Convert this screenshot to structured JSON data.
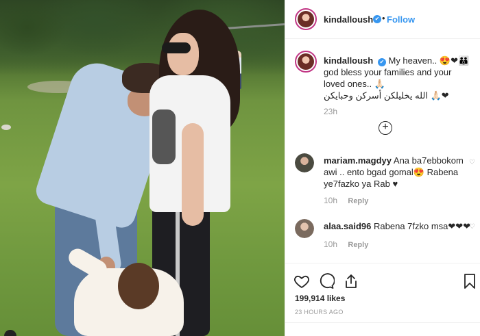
{
  "post": {
    "username": "kindalloush",
    "verified_mark": "✔",
    "dot": "•",
    "follow_label": "Follow",
    "caption": {
      "username": "kindalloush",
      "text_line1": "My heaven.. 😍❤👪",
      "text_line2": "god bless your families and your loved ones.. 🙏🏻",
      "text_arabic": "الله يخليلكن أسركن وحبايكن 🙏🏻❤"
    },
    "caption_time": "23h",
    "load_more_symbol": "+",
    "comments": [
      {
        "username": "mariam.magdyy",
        "text": "Ana ba7ebbokom awi .. ento bgad gomal😍 Rabena ye7fazko ya Rab ♥",
        "time": "10h",
        "reply_label": "Reply"
      },
      {
        "username": "alaa.said96",
        "text": "Rabena 7fzko msa❤❤❤",
        "time": "10h",
        "reply_label": "Reply"
      }
    ],
    "likes": "199,914 likes",
    "posted_ago": "23 HOURS AGO"
  },
  "icons": {
    "like": "heart-icon",
    "comment": "comment-icon",
    "share": "share-icon",
    "save": "bookmark-icon",
    "more": "plus-circle-icon"
  },
  "colors": {
    "accent": "#3897f0",
    "text": "#262626",
    "muted": "#999999",
    "story_ring": "#c13584"
  }
}
